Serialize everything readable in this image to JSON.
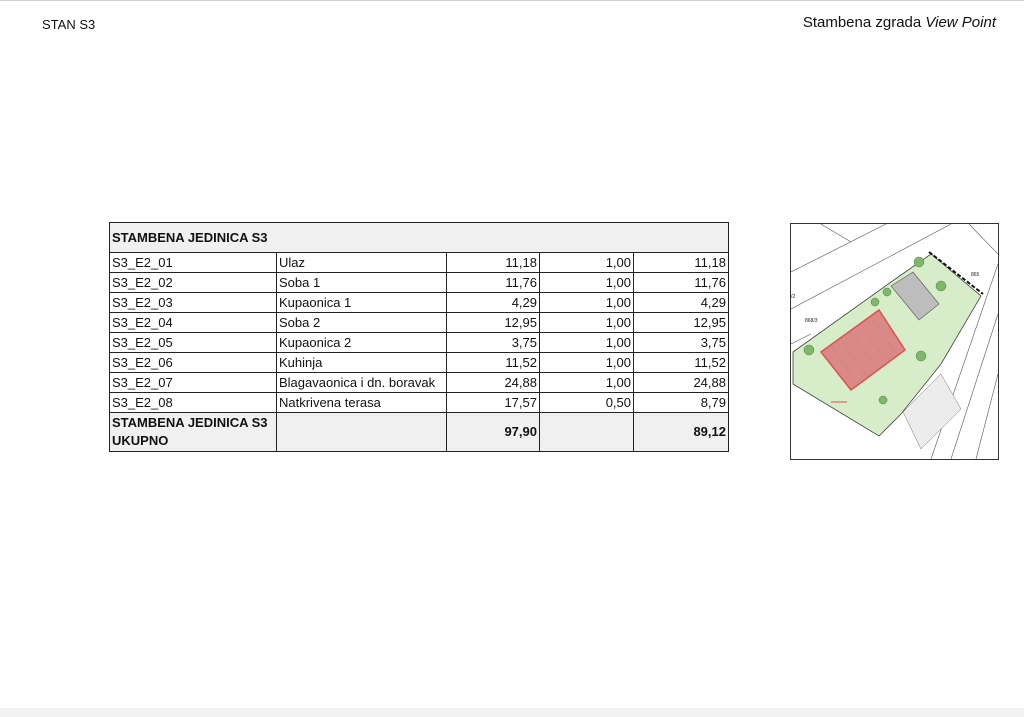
{
  "header": {
    "left_label": "STAN S3",
    "right_label_plain": "Stambena zgrada ",
    "right_label_italic": "View Point"
  },
  "table": {
    "title": "STAMBENA JEDINICA S3",
    "rows": [
      {
        "code": "S3_E2_01",
        "name": "Ulaz",
        "area": "11,18",
        "coef": "1,00",
        "net": "11,18"
      },
      {
        "code": "S3_E2_02",
        "name": "Soba 1",
        "area": "11,76",
        "coef": "1,00",
        "net": "11,76"
      },
      {
        "code": "S3_E2_03",
        "name": "Kupaonica 1",
        "area": "4,29",
        "coef": "1,00",
        "net": "4,29"
      },
      {
        "code": "S3_E2_04",
        "name": "Soba 2",
        "area": "12,95",
        "coef": "1,00",
        "net": "12,95"
      },
      {
        "code": "S3_E2_05",
        "name": "Kupaonica 2",
        "area": "3,75",
        "coef": "1,00",
        "net": "3,75"
      },
      {
        "code": "S3_E2_06",
        "name": "Kuhinja",
        "area": "11,52",
        "coef": "1,00",
        "net": "11,52"
      },
      {
        "code": "S3_E2_07",
        "name": "Blagavaonica i dn. boravak",
        "area": "24,88",
        "coef": "1,00",
        "net": "24,88"
      },
      {
        "code": "S3_E2_08",
        "name": "Natkrivena terasa",
        "area": "17,57",
        "coef": "0,50",
        "net": "8,79"
      }
    ],
    "total": {
      "label_line1": "STAMBENA JEDINICA S3",
      "label_line2": "UKUPNO",
      "area": "97,90",
      "net": "89,12"
    }
  },
  "site_plan": {
    "label_parcel_a": "865",
    "label_parcel_b": "868/3",
    "label_parcel_c": "/2",
    "colors": {
      "highlight_unit": "#d9534f",
      "greenery": "#cfe8c2",
      "building": "#bdbdbd"
    }
  }
}
